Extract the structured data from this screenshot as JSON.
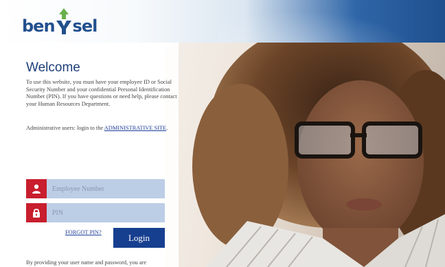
{
  "brand": {
    "logo_left": "ben",
    "logo_right": "sel",
    "colors": {
      "blue": "#23508e",
      "green": "#6ab04c",
      "red": "#c81e2d",
      "button": "#173f8f",
      "field": "#bccde6"
    }
  },
  "welcome": {
    "title": "Welcome",
    "intro": "To use this website, you must have your employee ID or Social Security Number and your confidential Personal Identification Number (PIN). If you have questions or need help, please contact your Human Resources Department.",
    "admin_prefix": "Administrative users: login to the ",
    "admin_link": "ADMINISTRATIVE SITE",
    "admin_suffix": "."
  },
  "form": {
    "employee_placeholder": "Employee Number",
    "employee_icon": "user-icon",
    "pin_placeholder": "PIN",
    "pin_icon": "lock-icon",
    "forgot_label": "FORGOT PIN?",
    "login_label": "Login"
  },
  "disclaimer": "By providing your user name and password, you are"
}
